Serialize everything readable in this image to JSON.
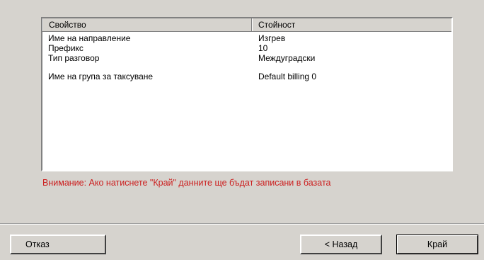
{
  "properties": {
    "headers": {
      "property": "Свойство",
      "value": "Стойност"
    },
    "rows": [
      {
        "property": "Име на направление",
        "value": "Изгрев"
      },
      {
        "property": "Префикс",
        "value": "10"
      },
      {
        "property": "Тип разговор",
        "value": "Междуградски"
      },
      {
        "property": "",
        "value": ""
      },
      {
        "property": "Име на група за таксуване",
        "value": "Default billing 0"
      }
    ]
  },
  "warning_text": "Внимание: Ако натиснете \"Край\" данните ще бъдат записани в базата",
  "colors": {
    "warning": "#cc1f1f",
    "window_bg": "#d6d3ce"
  },
  "buttons": {
    "cancel": "Отказ",
    "back": "< Назад",
    "finish": "Край"
  }
}
